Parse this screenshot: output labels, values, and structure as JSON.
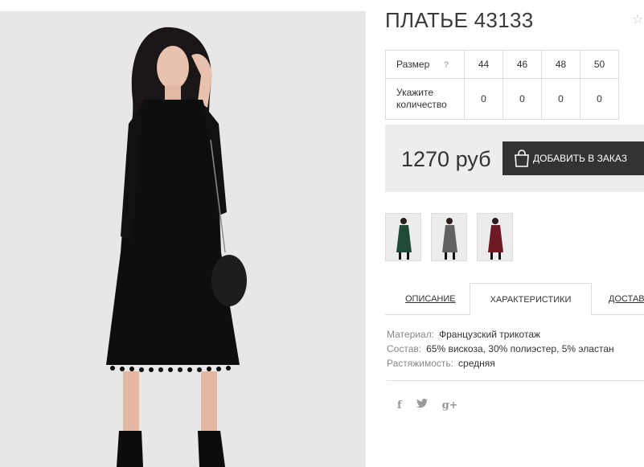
{
  "product": {
    "title": "ПЛАТЬЕ 43133",
    "favorite_icon": "star-icon"
  },
  "size_table": {
    "size_label": "Размер",
    "help_mark": "?",
    "sizes": [
      "44",
      "46",
      "48",
      "50"
    ],
    "quantity_label": "Укажите количество",
    "quantities": [
      "0",
      "0",
      "0",
      "0"
    ]
  },
  "purchase": {
    "price": "1270 руб",
    "add_to_cart_label": "ДОБАВИТЬ В ЗАКАЗ",
    "button_icon": "shopping-bag-icon"
  },
  "thumbnails": [
    {
      "color_name": "green",
      "dress_color": "#1f4a36"
    },
    {
      "color_name": "gray",
      "dress_color": "#5f6163"
    },
    {
      "color_name": "burgundy",
      "dress_color": "#6e1a26"
    }
  ],
  "tabs": [
    {
      "label": "ОПИСАНИЕ",
      "active": false
    },
    {
      "label": "ХАРАКТЕРИСТИКИ",
      "active": true
    },
    {
      "label": "ДОСТАВКА",
      "active": false
    }
  ],
  "specs": [
    {
      "key": "Материал:",
      "value": "Французский трикотаж"
    },
    {
      "key": "Состав:",
      "value": "65% вискоза, 30% полиэстер, 5% эластан"
    },
    {
      "key": "Растяжимость:",
      "value": "средняя"
    }
  ],
  "social": {
    "facebook": "f",
    "twitter": "t",
    "google_plus": "g+"
  },
  "colors": {
    "button_bg": "#333333",
    "price_block_bg": "#ededed",
    "border": "#dcdcdc"
  }
}
